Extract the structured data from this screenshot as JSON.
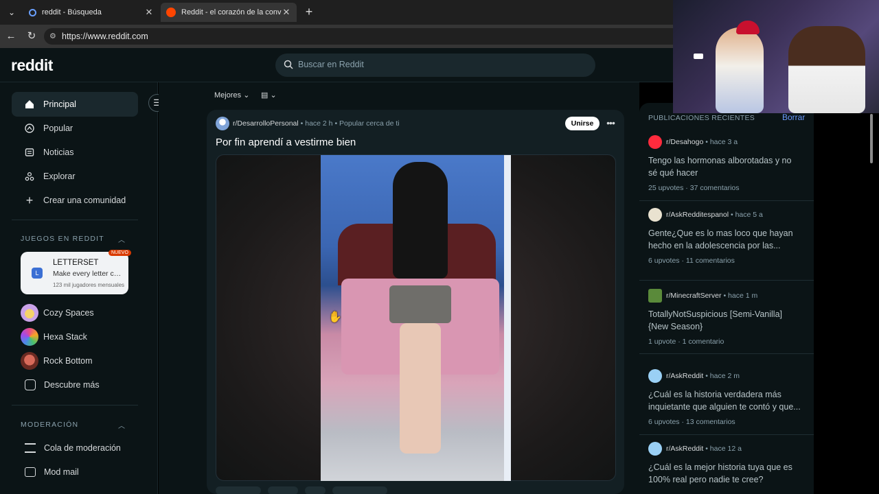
{
  "browser": {
    "tabs": [
      {
        "title": "reddit - Búsqueda"
      },
      {
        "title": "Reddit - el corazón de la conversación"
      }
    ],
    "url": "https://www.reddit.com"
  },
  "header": {
    "logo": "reddit",
    "search_placeholder": "Buscar en Reddit"
  },
  "sidebar": {
    "nav": [
      {
        "label": "Principal",
        "icon": "home-icon"
      },
      {
        "label": "Popular",
        "icon": "popular-icon"
      },
      {
        "label": "Noticias",
        "icon": "news-icon"
      },
      {
        "label": "Explorar",
        "icon": "explore-icon"
      },
      {
        "label": "Crear una comunidad",
        "icon": "plus-icon"
      }
    ],
    "games_title": "JUEGOS EN REDDIT",
    "featured_game": {
      "badge": "NUEVO",
      "title": "LETTERSET",
      "description": "Make every letter count",
      "players": "123 mil jugadores mensuales"
    },
    "games": [
      {
        "label": "Cozy Spaces",
        "color": "#c9a2e8"
      },
      {
        "label": "Hexa Stack",
        "color": "#e84a8a"
      },
      {
        "label": "Rock Bottom",
        "color": "#b84a3a"
      },
      {
        "label": "Descubre más",
        "color": "#d7dadc"
      }
    ],
    "moderation_title": "MODERACIÓN",
    "moderation": [
      {
        "label": "Cola de moderación"
      },
      {
        "label": "Mod mail"
      }
    ]
  },
  "feed": {
    "sort_label": "Mejores",
    "post": {
      "subreddit": "r/DesarrolloPersonal",
      "time": "hace 2 h",
      "extra": "Popular cerca de ti",
      "join_label": "Unirse",
      "title": "Por fin aprendí a vestirme bien"
    }
  },
  "recent": {
    "title": "PUBLICACIONES RECIENTES",
    "clear_label": "Borrar",
    "posts": [
      {
        "subreddit": "r/Desahogo",
        "time": "hace 3 a",
        "title": "Tengo las hormonas alborotadas y no sé qué hacer",
        "upvotes": "25 upvotes",
        "comments": "37 comentarios",
        "avatar_color": "#ff2b3d"
      },
      {
        "subreddit": "r/AskRedditespanol",
        "time": "hace 5 a",
        "title": "Gente¿Que es lo mas loco que hayan hecho en la adolescencia por las...",
        "upvotes": "6 upvotes",
        "comments": "11 comentarios",
        "avatar_color": "#e9e2d0"
      },
      {
        "subreddit": "r/MinecraftServer",
        "time": "hace 1 m",
        "title": "TotallyNotSuspicious [Semi-Vanilla] {New Season}",
        "upvotes": "1 upvote",
        "comments": "1 comentario",
        "avatar_color": "#5a8a3a"
      },
      {
        "subreddit": "r/AskReddit",
        "time": "hace 2 m",
        "title": "¿Cuál es la historia verdadera más inquietante que alguien te contó y que...",
        "upvotes": "6 upvotes",
        "comments": "13 comentarios",
        "avatar_color": "#9ad0f5"
      },
      {
        "subreddit": "r/AskReddit",
        "time": "hace 12 a",
        "title": "¿Cuál es la mejor historia tuya que es 100% real pero nadie te cree?",
        "upvotes": "",
        "comments": "",
        "avatar_color": "#9ad0f5"
      }
    ]
  }
}
